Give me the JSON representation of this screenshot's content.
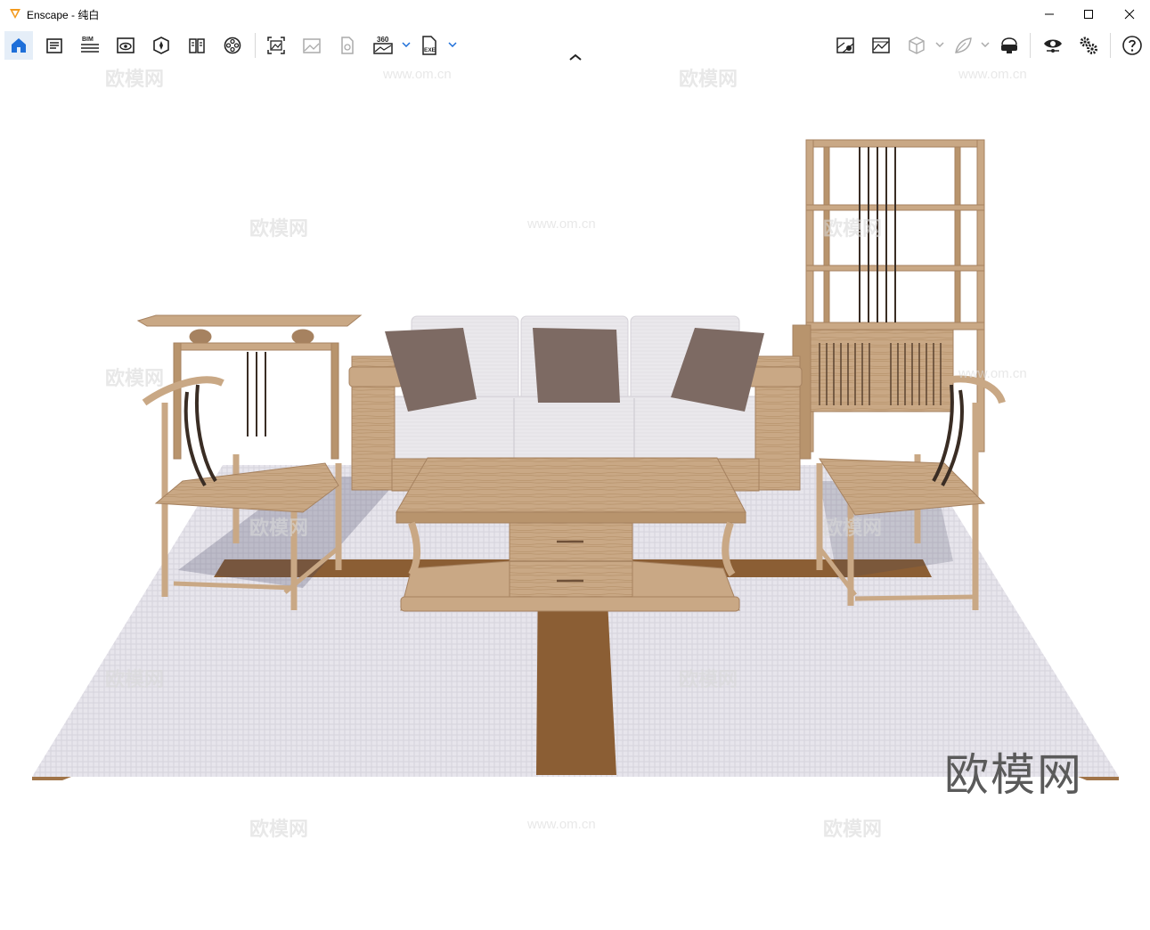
{
  "window": {
    "title": "Enscape - 纯白",
    "controls": {
      "minimize": "minimize",
      "maximize": "maximize",
      "close": "close"
    }
  },
  "toolbar": {
    "left_items": [
      {
        "icon": "home-icon",
        "active": true
      },
      {
        "icon": "notes-icon"
      },
      {
        "icon": "bim-icon",
        "label": "BIM"
      },
      {
        "icon": "view-settings-icon"
      },
      {
        "icon": "asset-library-icon"
      },
      {
        "icon": "book-icon"
      },
      {
        "icon": "video-reel-icon"
      },
      {
        "icon": "screenshot-icon"
      },
      {
        "icon": "gallery-icon"
      },
      {
        "icon": "export-file-icon"
      },
      {
        "icon": "panorama-360-icon",
        "label": "360"
      },
      {
        "icon": "exe-export-icon",
        "label": "EXE"
      }
    ],
    "right_items": [
      {
        "icon": "map-pin-icon"
      },
      {
        "icon": "image-view-icon"
      },
      {
        "icon": "cube-icon"
      },
      {
        "icon": "leaf-icon"
      },
      {
        "icon": "vr-headset-icon"
      },
      {
        "icon": "eye-icon"
      },
      {
        "icon": "settings-gears-icon"
      },
      {
        "icon": "help-icon"
      }
    ]
  },
  "viewport": {
    "scene": "living room furniture render",
    "watermarks": [
      "欧模网",
      "www.om.cn"
    ],
    "brand_text": "欧模网"
  },
  "colors": {
    "accent": "#1e6fd9",
    "logo": "#f39a1d",
    "wood": "#c8a783",
    "rug": "#e8e6ec",
    "rug_stripe": "#8b5e34",
    "cushion": "#7d6a63",
    "sofa": "#e9e7ea"
  }
}
